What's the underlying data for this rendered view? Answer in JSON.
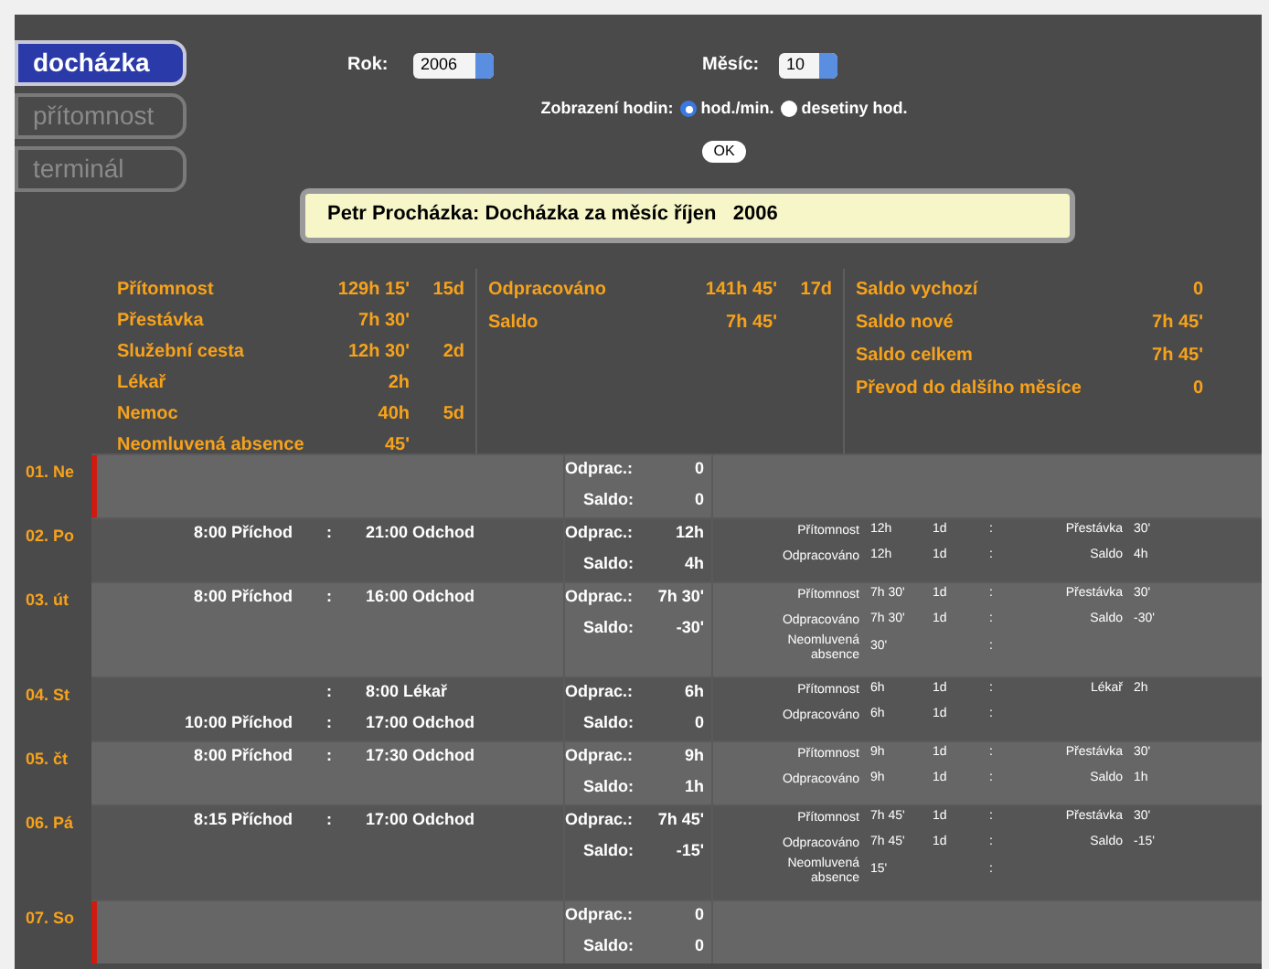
{
  "nav": [
    {
      "label": "docházka",
      "selected": true
    },
    {
      "label": "přítomnost",
      "selected": false
    },
    {
      "label": "terminál",
      "selected": false
    }
  ],
  "filters": {
    "year_label": "Rok:",
    "year": "2006",
    "month_label": "Měsíc:",
    "month": "10",
    "hours_label": "Zobrazení hodin:",
    "hours_options": [
      {
        "label": "hod./min.",
        "selected": true
      },
      {
        "label": "desetiny hod.",
        "selected": false
      }
    ],
    "ok": "OK"
  },
  "title": "Petr Procházka: Docházka za měsíc říjen   2006",
  "summary": {
    "col1": [
      {
        "label": "Přítomnost",
        "value": "129h 15'",
        "days": "15d"
      },
      {
        "label": "Přestávka",
        "value": "7h 30'"
      },
      {
        "label": "Služební cesta",
        "value": "12h 30'",
        "days": "2d"
      },
      {
        "label": "Lékař",
        "value": "2h"
      },
      {
        "label": "Nemoc",
        "value": "40h",
        "days": "5d"
      },
      {
        "label": "Neomluvená absence",
        "value": "45'"
      }
    ],
    "col2": [
      {
        "label": "Odpracováno",
        "value": "141h 45'",
        "days": "17d"
      },
      {
        "label": "Saldo",
        "value": "7h 45'"
      }
    ],
    "col3": [
      {
        "label": "Saldo vychozí",
        "value": "0"
      },
      {
        "label": "Saldo nové",
        "value": "7h 45'"
      },
      {
        "label": "Saldo celkem",
        "value": "7h 45'"
      },
      {
        "label": "Převod do dalšího měsíce",
        "value": "0"
      }
    ]
  },
  "days": [
    {
      "label": "01. Ne",
      "weekend": true,
      "odprac_label": "Odprac.:",
      "odprac": "0",
      "saldo_label": "Saldo:",
      "saldo": "0"
    },
    {
      "label": "02. Po",
      "weekend": false,
      "entries": [
        {
          "from": "8:00 Příchod",
          "sep": ":",
          "to": "21:00 Odchod"
        }
      ],
      "odprac_label": "Odprac.:",
      "odprac": "12h",
      "saldo_label": "Saldo:",
      "saldo": "4h",
      "stats": [
        {
          "label": "Přítomnost",
          "value": "12h",
          "days": "1d",
          "sep": ":",
          "label2": "Přestávka",
          "value2": "30'"
        },
        {
          "label": "Odpracováno",
          "value": "12h",
          "days": "1d",
          "sep": ":",
          "label2": "Saldo",
          "value2": "4h"
        }
      ]
    },
    {
      "label": "03. út",
      "weekend": false,
      "entries": [
        {
          "from": "8:00 Příchod",
          "sep": ":",
          "to": "16:00 Odchod"
        }
      ],
      "odprac_label": "Odprac.:",
      "odprac": "7h 30'",
      "saldo_label": "Saldo:",
      "saldo": "-30'",
      "stats": [
        {
          "label": "Přítomnost",
          "value": "7h 30'",
          "days": "1d",
          "sep": ":",
          "label2": "Přestávka",
          "value2": "30'"
        },
        {
          "label": "Odpracováno",
          "value": "7h 30'",
          "days": "1d",
          "sep": ":",
          "label2": "Saldo",
          "value2": "-30'"
        },
        {
          "label": "Neomluvená absence",
          "value": "30'",
          "sep": ":"
        }
      ]
    },
    {
      "label": "04. St",
      "weekend": false,
      "entries": [
        {
          "sep": ":",
          "to": "8:00 Lékař"
        },
        {
          "from": "10:00 Příchod",
          "sep": ":",
          "to": "17:00 Odchod"
        }
      ],
      "odprac_label": "Odprac.:",
      "odprac": "6h",
      "saldo_label": "Saldo:",
      "saldo": "0",
      "stats": [
        {
          "label": "Přítomnost",
          "value": "6h",
          "days": "1d",
          "sep": ":",
          "label2": "Lékař",
          "value2": "2h"
        },
        {
          "label": "Odpracováno",
          "value": "6h",
          "days": "1d",
          "sep": ":"
        }
      ]
    },
    {
      "label": "05. čt",
      "weekend": false,
      "entries": [
        {
          "from": "8:00 Příchod",
          "sep": ":",
          "to": "17:30 Odchod"
        }
      ],
      "odprac_label": "Odprac.:",
      "odprac": "9h",
      "saldo_label": "Saldo:",
      "saldo": "1h",
      "stats": [
        {
          "label": "Přítomnost",
          "value": "9h",
          "days": "1d",
          "sep": ":",
          "label2": "Přestávka",
          "value2": "30'"
        },
        {
          "label": "Odpracováno",
          "value": "9h",
          "days": "1d",
          "sep": ":",
          "label2": "Saldo",
          "value2": "1h"
        }
      ]
    },
    {
      "label": "06. Pá",
      "weekend": false,
      "entries": [
        {
          "from": "8:15 Příchod",
          "sep": ":",
          "to": "17:00 Odchod"
        }
      ],
      "odprac_label": "Odprac.:",
      "odprac": "7h 45'",
      "saldo_label": "Saldo:",
      "saldo": "-15'",
      "stats": [
        {
          "label": "Přítomnost",
          "value": "7h 45'",
          "days": "1d",
          "sep": ":",
          "label2": "Přestávka",
          "value2": "30'"
        },
        {
          "label": "Odpracováno",
          "value": "7h 45'",
          "days": "1d",
          "sep": ":",
          "label2": "Saldo",
          "value2": "-15'"
        },
        {
          "label": "Neomluvená absence",
          "value": "15'",
          "sep": ":"
        }
      ]
    },
    {
      "label": "07. So",
      "weekend": true,
      "odprac_label": "Odprac.:",
      "odprac": "0",
      "saldo_label": "Saldo:",
      "saldo": "0"
    }
  ]
}
